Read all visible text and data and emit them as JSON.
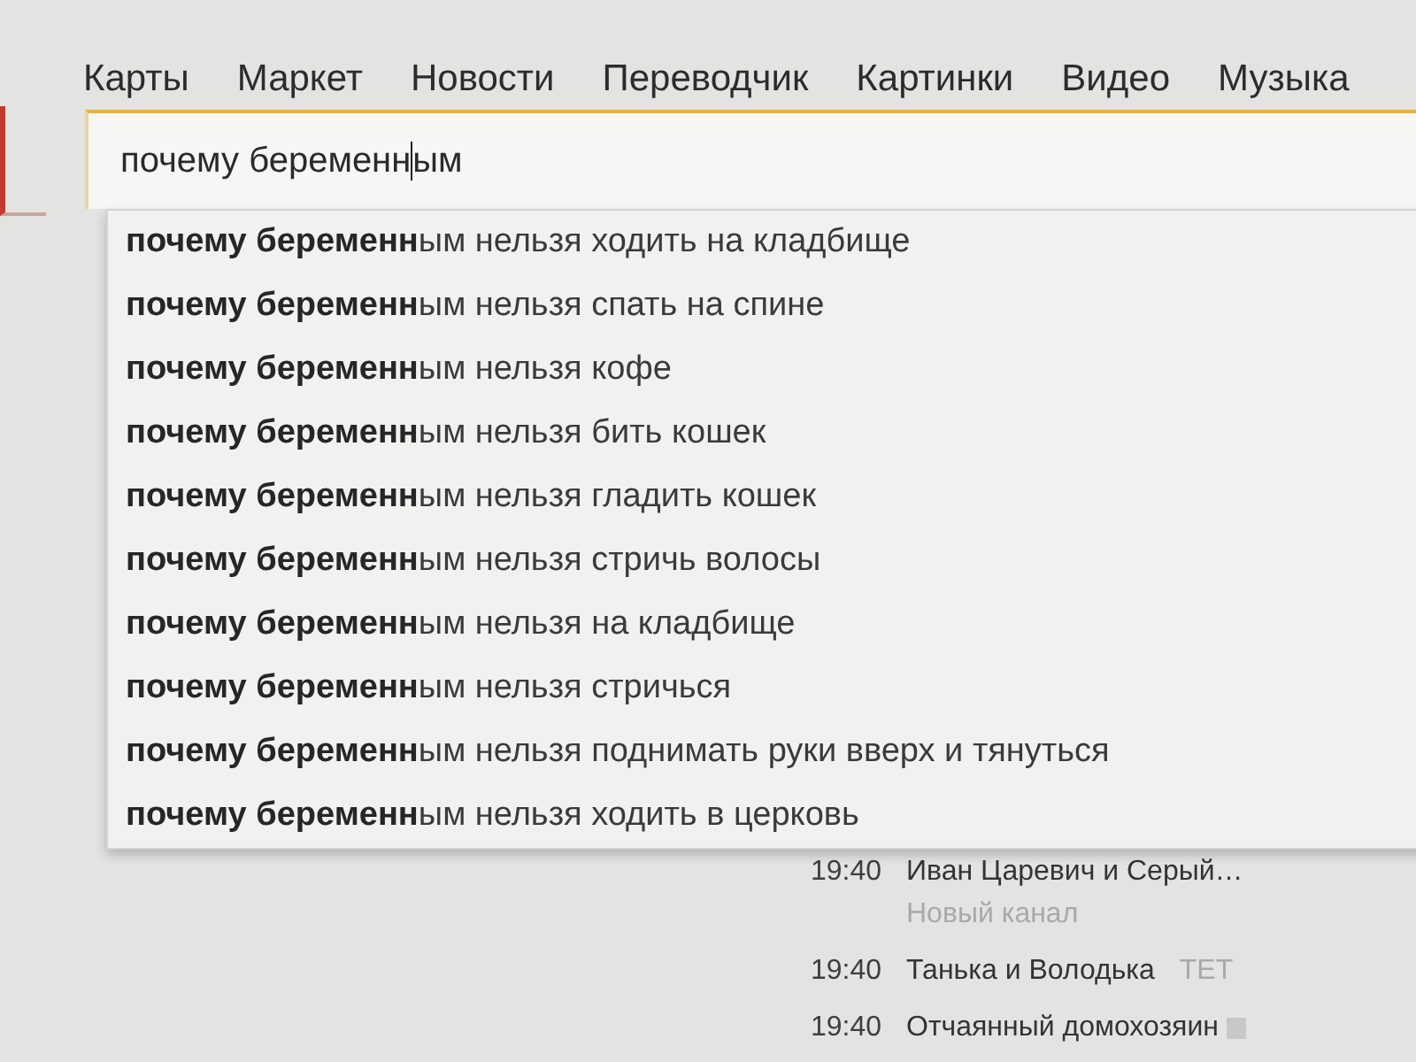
{
  "nav": {
    "links": [
      "Карты",
      "Маркет",
      "Новости",
      "Переводчик",
      "Картинки",
      "Видео",
      "Музыка"
    ]
  },
  "search": {
    "value_before_caret": "почему беременн",
    "value_after_caret": "ым"
  },
  "suggestions": [
    "**почему беременн**ым нельзя ходить на кладбище",
    "**почему беременн**ым нельзя спать на спине",
    "**почему беременн**ым нельзя кофе",
    "**почему беременн**ым нельзя бить кошек",
    "**почему беременн**ым нельзя гладить кошек",
    "**почему беременн**ым нельзя стричь волосы",
    "**почему беременн**ым нельзя на кладбище",
    "**почему беременн**ым нельзя стричься",
    "**почему беременн**ым нельзя поднимать руки вверх и тянуться",
    "**почему беременн**ым нельзя ходить в церковь"
  ],
  "tv_schedule": [
    {
      "kind": "stacked",
      "time": "19:40",
      "title": "Иван Царевич и Серый…",
      "channel": "Новый канал"
    },
    {
      "kind": "inline",
      "time": "19:40",
      "title": "Танька и Володька",
      "channel": "ТЕТ"
    },
    {
      "kind": "logo",
      "time": "19:40",
      "title": "Отчаянный домохозяин"
    }
  ]
}
